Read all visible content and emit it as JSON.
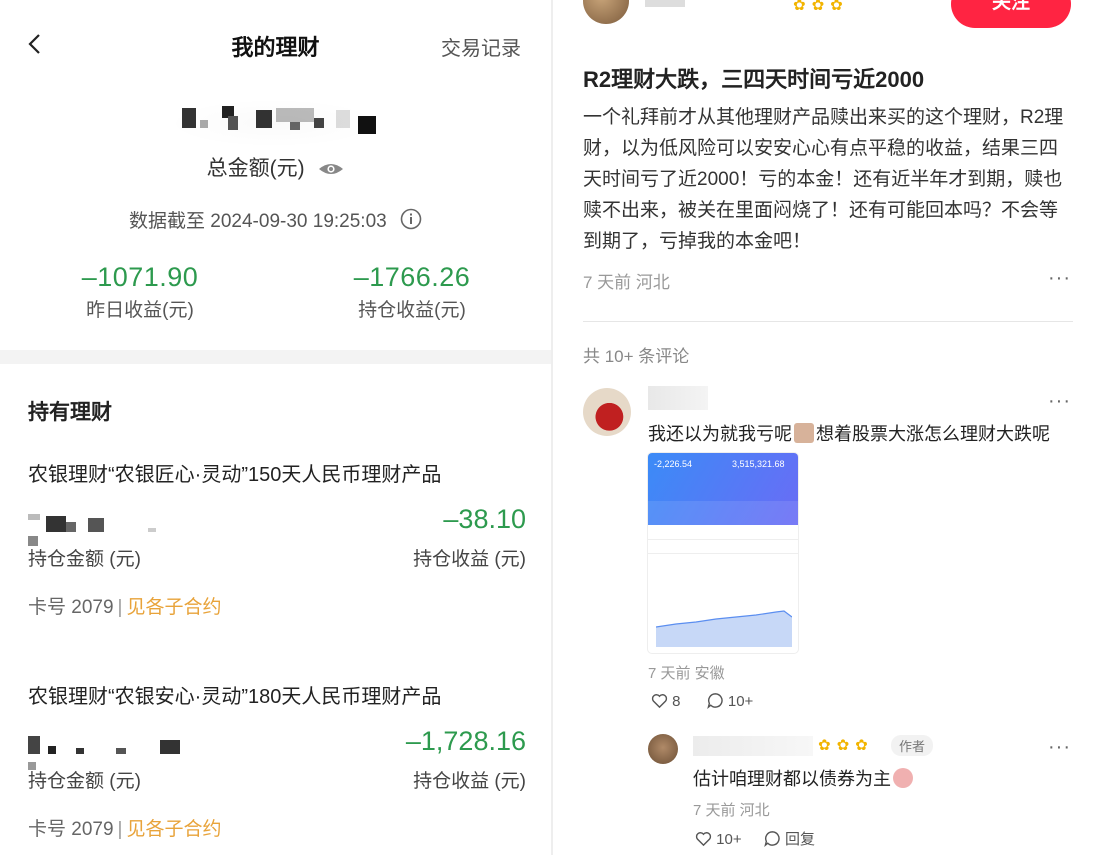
{
  "left": {
    "nav": {
      "title": "我的理财",
      "right_link": "交易记录"
    },
    "summary": {
      "total_label": "总金额(元)",
      "as_of": "数据截至 2024-09-30 19:25:03",
      "yesterday_value": "–1071.90",
      "yesterday_label": "昨日收益(元)",
      "holding_value": "–1766.26",
      "holding_label": "持仓收益(元)"
    },
    "holdings_title": "持有理财",
    "products": [
      {
        "name": "农银理财“农银匠心·灵动”150天人民币理财产品",
        "gain": "–38.10",
        "amount_label": "持仓金额 (元)",
        "gain_label": "持仓收益 (元)",
        "card": "卡号 2079",
        "sep": "|",
        "link": "见各子合约"
      },
      {
        "name": "农银理财“农银安心·灵动”180天人民币理财产品",
        "gain": "–1,728.16",
        "amount_label": "持仓金额 (元)",
        "gain_label": "持仓收益 (元)",
        "card": "卡号 2079",
        "sep": "|",
        "link": "见各子合约"
      }
    ]
  },
  "right": {
    "follow_label": "关注",
    "post": {
      "title": "R2理财大跌，三四天时间亏近2000",
      "body": "一个礼拜前才从其他理财产品赎出来买的这个理财，R2理财，以为低风险可以安安心心有点平稳的收益，结果三四天时间亏了近2000！亏的本金！还有近半年才到期，赎也赎不出来，被关在里面闷烧了！还有可能回本吗？不会等到期了，亏掉我的本金吧！",
      "meta": "7 天前 河北",
      "more": "···"
    },
    "comment_count": "共 10+ 条评论",
    "comment1": {
      "text_a": "我还以为就我亏呢",
      "text_b": "想着股票大涨怎么理财大跌呢",
      "meta": "7 天前 安徽",
      "likes": "8",
      "replies": "10+",
      "shot": {
        "n1": "-2,226.54",
        "n2": "3,515,321.68"
      }
    },
    "comment2": {
      "tag": "作者",
      "text": "估计咱理财都以债券为主",
      "meta": "7 天前 河北",
      "likes": "10+",
      "reply": "回复"
    }
  },
  "colors": {
    "gain_green": "#2d9a4e",
    "follow_red": "#ff2442",
    "link_orange": "#e8a33a"
  }
}
